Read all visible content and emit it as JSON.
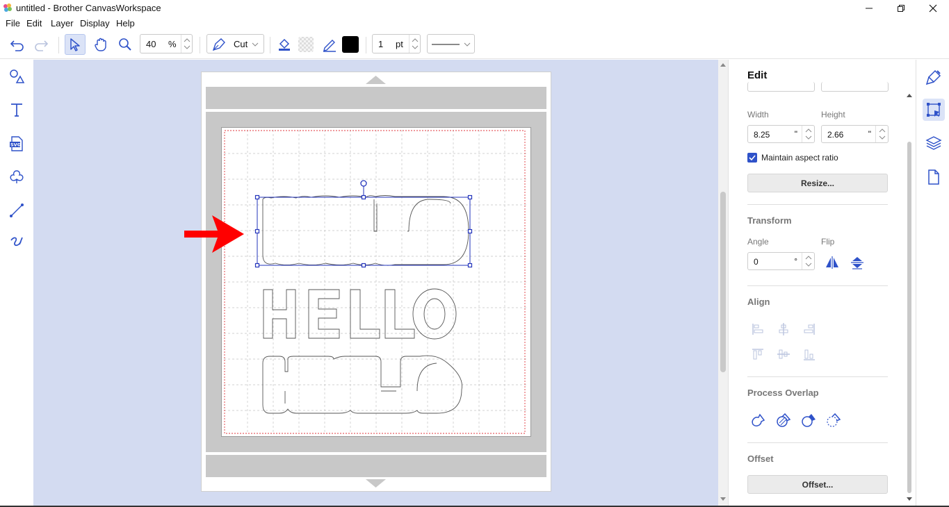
{
  "window": {
    "title": "untitled - Brother CanvasWorkspace",
    "controls": [
      "minimize-icon",
      "restore-icon",
      "close-icon"
    ]
  },
  "menu": [
    "File",
    "Edit",
    "Layer",
    "Display",
    "Help"
  ],
  "toolbar": {
    "zoom_value": "40",
    "zoom_unit": "%",
    "mode_label": "Cut",
    "line_width_value": "1",
    "line_width_unit": "pt",
    "fill_color": "#000000",
    "accent": "#2f52c9"
  },
  "left_tools": [
    "shapes-icon",
    "text-icon",
    "svg-import-icon",
    "pattern-icon",
    "line-icon",
    "freehand-icon"
  ],
  "canvas": {
    "texts": [
      "HELLO"
    ],
    "arrow_color": "#ff0000",
    "cut_margin_color": "#e0353b"
  },
  "edit_panel": {
    "title": "Edit",
    "width_label": "Width",
    "height_label": "Height",
    "width_value": "8.25",
    "height_value": "2.66",
    "inch_unit": "\"",
    "maintain_aspect_label": "Maintain aspect ratio",
    "maintain_aspect_checked": true,
    "resize_button": "Resize...",
    "transform_title": "Transform",
    "angle_label": "Angle",
    "angle_value": "0",
    "angle_unit": "°",
    "flip_label": "Flip",
    "align_title": "Align",
    "process_overlap_title": "Process Overlap",
    "offset_title": "Offset",
    "offset_button": "Offset..."
  },
  "right_strip": [
    "paint-icon",
    "edit-transform-icon",
    "layers-icon",
    "page-icon"
  ]
}
